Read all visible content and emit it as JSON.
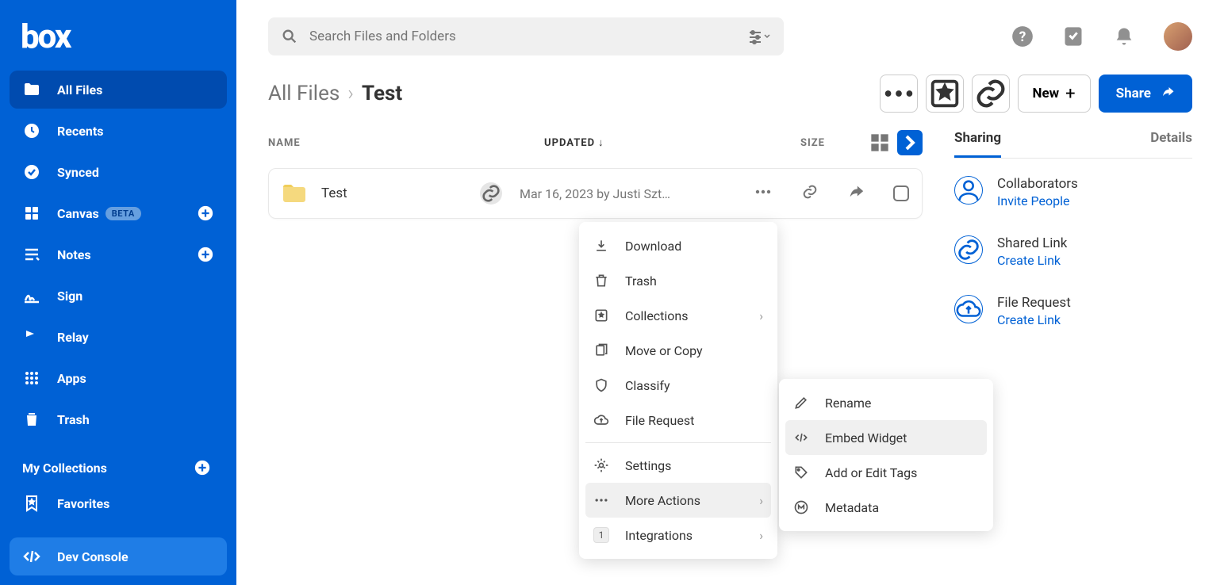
{
  "brand": "box",
  "search": {
    "placeholder": "Search Files and Folders"
  },
  "sidebar": {
    "items": [
      {
        "label": "All Files"
      },
      {
        "label": "Recents"
      },
      {
        "label": "Synced"
      },
      {
        "label": "Canvas",
        "badge": "BETA"
      },
      {
        "label": "Notes"
      },
      {
        "label": "Sign"
      },
      {
        "label": "Relay"
      },
      {
        "label": "Apps"
      },
      {
        "label": "Trash"
      }
    ],
    "collections_header": "My Collections",
    "favorites": "Favorites",
    "dev_console": "Dev Console"
  },
  "breadcrumb": {
    "root": "All Files",
    "current": "Test"
  },
  "toolbar": {
    "new_label": "New",
    "share_label": "Share"
  },
  "columns": {
    "name": "NAME",
    "updated": "UPDATED",
    "size": "SIZE"
  },
  "file_row": {
    "name": "Test",
    "updated": "Mar 16, 2023 by Justi Szt…"
  },
  "context_menu": {
    "download": "Download",
    "trash": "Trash",
    "collections": "Collections",
    "move_copy": "Move or Copy",
    "classify": "Classify",
    "file_request": "File Request",
    "settings": "Settings",
    "more_actions": "More Actions",
    "integrations": "Integrations",
    "integrations_count": "1"
  },
  "submenu": {
    "rename": "Rename",
    "embed_widget": "Embed Widget",
    "add_edit_tags": "Add or Edit Tags",
    "metadata": "Metadata"
  },
  "side_panel": {
    "tabs": {
      "sharing": "Sharing",
      "details": "Details"
    },
    "collab_title": "Collaborators",
    "collab_link": "Invite People",
    "shared_title": "Shared Link",
    "shared_link": "Create Link",
    "request_title": "File Request",
    "request_link": "Create Link"
  }
}
